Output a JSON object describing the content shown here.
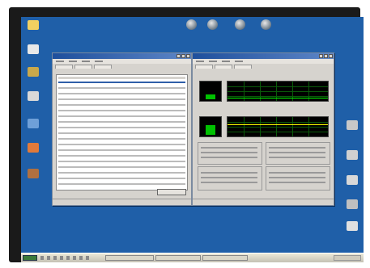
{
  "desktop": {
    "left_icons": [
      {
        "icon": "my-computer-icon",
        "color": "#f0d060"
      },
      {
        "icon": "documents-icon",
        "color": "#e8e8e8"
      },
      {
        "icon": "network-icon",
        "color": "#c9a84a"
      },
      {
        "icon": "recycle-bin-icon",
        "color": "#d8d8d8"
      },
      {
        "icon": "internet-icon",
        "color": "#6fa0d8"
      },
      {
        "icon": "app-icon",
        "color": "#e07a3a"
      },
      {
        "icon": "shortcut-icon",
        "color": "#b07040"
      }
    ],
    "right_icons": [
      {
        "icon": "drive-icon",
        "color": "#c8c8c8"
      },
      {
        "icon": "drive-icon",
        "color": "#d0d0d0"
      },
      {
        "icon": "drive-icon",
        "color": "#d8d8d8"
      },
      {
        "icon": "drive-icon",
        "color": "#c0c0c0"
      },
      {
        "icon": "printer-icon",
        "color": "#e0e0e0"
      }
    ],
    "top_icons": [
      "globe-icon",
      "globe-icon",
      "globe-icon",
      "globe-icon"
    ],
    "background": "#1f5fa8"
  },
  "task_manager_processes": {
    "title": "",
    "rows": 19
  },
  "task_manager_performance": {
    "title": "",
    "cpu_graph_color": "#00ff00",
    "memory_graph_color": "#00ff00"
  },
  "taskbar": {
    "start_label": "",
    "items": 3
  }
}
